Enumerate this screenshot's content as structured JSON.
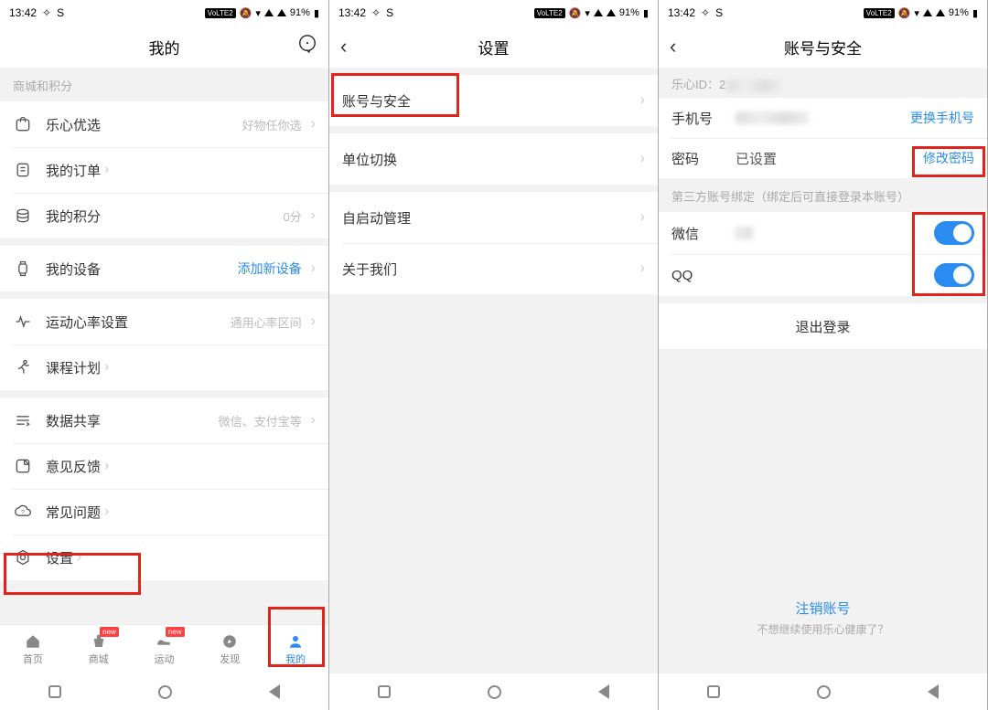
{
  "status": {
    "time": "13:42",
    "net_badge": "VoLTE2",
    "battery": "91%"
  },
  "screen1": {
    "title": "我的",
    "section1_label": "商城和积分",
    "items": {
      "youxuan": {
        "label": "乐心优选",
        "value": "好物任你选"
      },
      "orders": {
        "label": "我的订单"
      },
      "points": {
        "label": "我的积分",
        "value": "0分"
      },
      "devices": {
        "label": "我的设备",
        "value": "添加新设备"
      },
      "hr": {
        "label": "运动心率设置",
        "value": "通用心率区间"
      },
      "plan": {
        "label": "课程计划"
      },
      "share": {
        "label": "数据共享",
        "value": "微信、支付宝等"
      },
      "feedback": {
        "label": "意见反馈"
      },
      "faq": {
        "label": "常见问题"
      },
      "settings": {
        "label": "设置"
      }
    },
    "tabs": {
      "home": "首页",
      "mall": "商城",
      "sport": "运动",
      "discover": "发现",
      "mine": "我的",
      "new_badge": "new"
    }
  },
  "screen2": {
    "title": "设置",
    "items": {
      "account": "账号与安全",
      "unit": "单位切换",
      "autostart": "自启动管理",
      "about": "关于我们"
    }
  },
  "screen3": {
    "title": "账号与安全",
    "id_label": "乐心ID：2",
    "phone_label": "手机号",
    "phone_action": "更换手机号",
    "pwd_label": "密码",
    "pwd_value": "已设置",
    "pwd_action": "修改密码",
    "thirdparty_label": "第三方账号绑定（绑定后可直接登录本账号）",
    "wechat": "微信",
    "qq": "QQ",
    "logout": "退出登录",
    "cancel_account": "注销账号",
    "cancel_sub": "不想继续使用乐心健康了？"
  }
}
